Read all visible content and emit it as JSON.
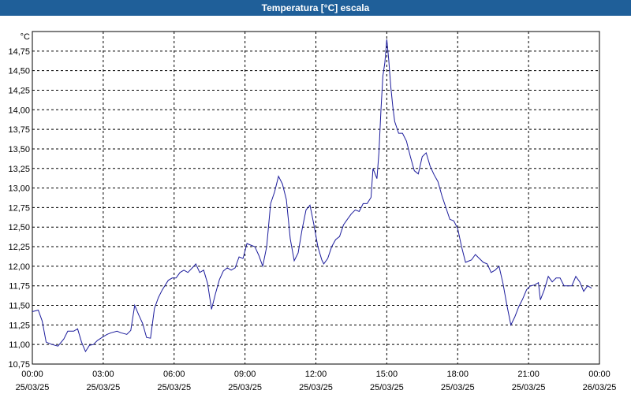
{
  "window": {
    "title": "Temperatura [°C] escala"
  },
  "chart_data": {
    "type": "line",
    "title": "Temperatura [°C] escala",
    "ylabel": "°C",
    "xlabel": "",
    "ylim": [
      10.75,
      15.0
    ],
    "xlim": [
      "25/03/25 00:00",
      "26/03/25 00:00"
    ],
    "yticks": [
      "10,75",
      "11,00",
      "11,25",
      "11,50",
      "11,75",
      "12,00",
      "12,25",
      "12,50",
      "12,75",
      "13,00",
      "13,25",
      "13,50",
      "13,75",
      "14,00",
      "14,25",
      "14,50",
      "14,75"
    ],
    "xticks": [
      {
        "time": "00:00",
        "date": "25/03/25"
      },
      {
        "time": "03:00",
        "date": "25/03/25"
      },
      {
        "time": "06:00",
        "date": "25/03/25"
      },
      {
        "time": "09:00",
        "date": "25/03/25"
      },
      {
        "time": "12:00",
        "date": "25/03/25"
      },
      {
        "time": "15:00",
        "date": "25/03/25"
      },
      {
        "time": "18:00",
        "date": "25/03/25"
      },
      {
        "time": "21:00",
        "date": "25/03/25"
      },
      {
        "time": "00:00",
        "date": "26/03/25"
      }
    ],
    "grid": true,
    "line_color": "#1c1c9c",
    "series": [
      {
        "points": [
          [
            "00:00",
            11.42
          ],
          [
            "00:15",
            11.44
          ],
          [
            "00:25",
            11.3
          ],
          [
            "00:35",
            11.03
          ],
          [
            "00:50",
            11.0
          ],
          [
            "01:05",
            10.98
          ],
          [
            "01:20",
            11.07
          ],
          [
            "01:30",
            11.17
          ],
          [
            "01:45",
            11.17
          ],
          [
            "01:55",
            11.2
          ],
          [
            "02:05",
            11.03
          ],
          [
            "02:15",
            10.91
          ],
          [
            "02:25",
            10.99
          ],
          [
            "02:35",
            11.0
          ],
          [
            "02:45",
            11.05
          ],
          [
            "03:00",
            11.1
          ],
          [
            "03:10",
            11.13
          ],
          [
            "03:20",
            11.15
          ],
          [
            "03:35",
            11.17
          ],
          [
            "03:45",
            11.15
          ],
          [
            "04:00",
            11.13
          ],
          [
            "04:10",
            11.18
          ],
          [
            "04:20",
            11.5
          ],
          [
            "04:30",
            11.38
          ],
          [
            "04:40",
            11.27
          ],
          [
            "04:50",
            11.09
          ],
          [
            "05:00",
            11.08
          ],
          [
            "05:10",
            11.46
          ],
          [
            "05:20",
            11.6
          ],
          [
            "05:30",
            11.7
          ],
          [
            "05:45",
            11.82
          ],
          [
            "05:55",
            11.85
          ],
          [
            "06:05",
            11.85
          ],
          [
            "06:15",
            11.92
          ],
          [
            "06:25",
            11.95
          ],
          [
            "06:35",
            11.92
          ],
          [
            "06:50",
            12.0
          ],
          [
            "06:55",
            12.03
          ],
          [
            "07:05",
            11.92
          ],
          [
            "07:15",
            11.95
          ],
          [
            "07:25",
            11.78
          ],
          [
            "07:35",
            11.45
          ],
          [
            "07:45",
            11.65
          ],
          [
            "07:55",
            11.83
          ],
          [
            "08:05",
            11.94
          ],
          [
            "08:15",
            11.98
          ],
          [
            "08:25",
            11.95
          ],
          [
            "08:35",
            11.98
          ],
          [
            "08:45",
            12.12
          ],
          [
            "08:55",
            12.1
          ],
          [
            "09:05",
            12.29
          ],
          [
            "09:15",
            12.27
          ],
          [
            "09:25",
            12.25
          ],
          [
            "09:35",
            12.14
          ],
          [
            "09:45",
            12.0
          ],
          [
            "09:55",
            12.25
          ],
          [
            "10:05",
            12.8
          ],
          [
            "10:15",
            12.95
          ],
          [
            "10:25",
            13.15
          ],
          [
            "10:35",
            13.05
          ],
          [
            "10:45",
            12.85
          ],
          [
            "10:55",
            12.35
          ],
          [
            "11:05",
            12.07
          ],
          [
            "11:15",
            12.17
          ],
          [
            "11:25",
            12.47
          ],
          [
            "11:35",
            12.72
          ],
          [
            "11:45",
            12.78
          ],
          [
            "11:55",
            12.53
          ],
          [
            "12:05",
            12.25
          ],
          [
            "12:15",
            12.08
          ],
          [
            "12:20",
            12.03
          ],
          [
            "12:30",
            12.1
          ],
          [
            "12:40",
            12.25
          ],
          [
            "12:50",
            12.34
          ],
          [
            "13:00",
            12.38
          ],
          [
            "13:10",
            12.53
          ],
          [
            "13:20",
            12.6
          ],
          [
            "13:30",
            12.67
          ],
          [
            "13:40",
            12.72
          ],
          [
            "13:50",
            12.7
          ],
          [
            "14:00",
            12.8
          ],
          [
            "14:10",
            12.8
          ],
          [
            "14:20",
            12.88
          ],
          [
            "14:25",
            13.25
          ],
          [
            "14:35",
            13.12
          ],
          [
            "14:40",
            13.45
          ],
          [
            "14:45",
            13.98
          ],
          [
            "14:50",
            14.43
          ],
          [
            "14:55",
            14.6
          ],
          [
            "15:00",
            14.9
          ],
          [
            "15:05",
            14.63
          ],
          [
            "15:10",
            14.3
          ],
          [
            "15:15",
            14.05
          ],
          [
            "15:20",
            13.85
          ],
          [
            "15:30",
            13.7
          ],
          [
            "15:40",
            13.7
          ],
          [
            "15:50",
            13.6
          ],
          [
            "16:00",
            13.4
          ],
          [
            "16:10",
            13.22
          ],
          [
            "16:20",
            13.18
          ],
          [
            "16:30",
            13.4
          ],
          [
            "16:40",
            13.45
          ],
          [
            "16:50",
            13.28
          ],
          [
            "17:00",
            13.17
          ],
          [
            "17:10",
            13.08
          ],
          [
            "17:20",
            12.9
          ],
          [
            "17:30",
            12.75
          ],
          [
            "17:40",
            12.6
          ],
          [
            "17:50",
            12.58
          ],
          [
            "18:00",
            12.48
          ],
          [
            "18:10",
            12.25
          ],
          [
            "18:20",
            12.05
          ],
          [
            "18:35",
            12.08
          ],
          [
            "18:45",
            12.15
          ],
          [
            "18:55",
            12.1
          ],
          [
            "19:05",
            12.05
          ],
          [
            "19:15",
            12.03
          ],
          [
            "19:25",
            11.92
          ],
          [
            "19:35",
            11.95
          ],
          [
            "19:45",
            12.0
          ],
          [
            "19:55",
            11.78
          ],
          [
            "20:05",
            11.5
          ],
          [
            "20:15",
            11.25
          ],
          [
            "20:25",
            11.35
          ],
          [
            "20:35",
            11.48
          ],
          [
            "20:45",
            11.58
          ],
          [
            "20:55",
            11.7
          ],
          [
            "21:05",
            11.75
          ],
          [
            "21:15",
            11.76
          ],
          [
            "21:25",
            11.79
          ],
          [
            "21:30",
            11.57
          ],
          [
            "21:40",
            11.7
          ],
          [
            "21:50",
            11.87
          ],
          [
            "22:00",
            11.8
          ],
          [
            "22:10",
            11.85
          ],
          [
            "22:20",
            11.85
          ],
          [
            "22:30",
            11.75
          ],
          [
            "22:40",
            11.75
          ],
          [
            "22:50",
            11.75
          ],
          [
            "23:00",
            11.87
          ],
          [
            "23:10",
            11.8
          ],
          [
            "23:20",
            11.68
          ],
          [
            "23:30",
            11.75
          ],
          [
            "23:40",
            11.72
          ]
        ]
      }
    ]
  }
}
